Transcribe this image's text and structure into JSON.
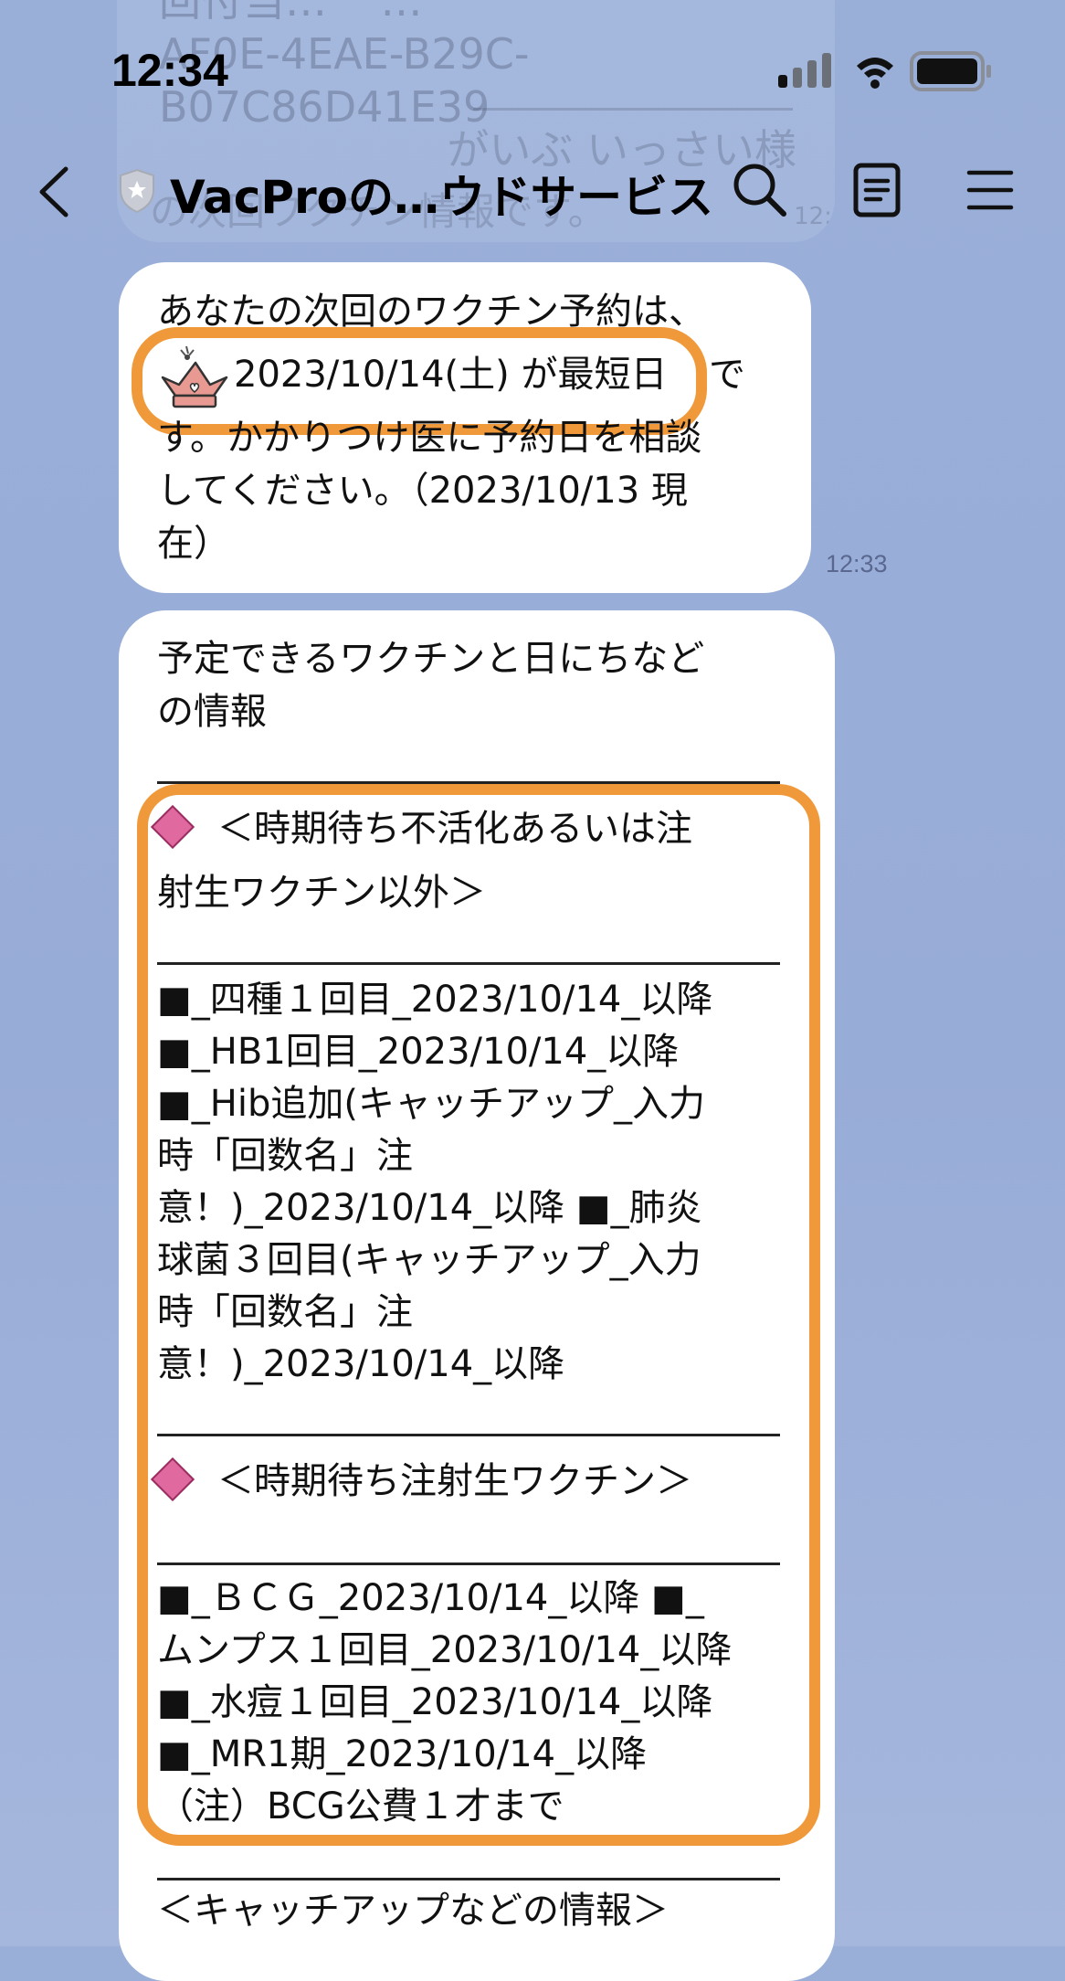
{
  "status_bar": {
    "time": "12:34"
  },
  "background_ghost": {
    "line1": "回付当…    …",
    "line2": "AF0E-4EAE-B29C-",
    "line3": "B07C86D41E39",
    "greeting": "がいぶ いっさい様",
    "line5": "の次回ワクチン情報です。",
    "time": "12:28"
  },
  "header": {
    "title": "VacProの…ウドサービス",
    "icons": [
      "back-arrow-icon",
      "shield-icon",
      "search-icon",
      "notes-icon",
      "menu-icon"
    ]
  },
  "message1": {
    "line1": "あなたの次回のワクチン予約は、",
    "highlight_date": "2023/10/14(土) が最短日",
    "line2_tail": "で",
    "line3": "す。かかりつけ医に予約日を相談",
    "line4": "してください。（2023/10/13 現",
    "line5": "在）",
    "timestamp": "12:33"
  },
  "message2": {
    "heading1": "予定できるワクチンと日にちなど",
    "heading2": "の情報",
    "section1_title1": "＜時期待ち不活化あるいは注",
    "section1_title2": "射生ワクチン以外＞",
    "section1_lines": [
      "■_四種１回目_2023/10/14_以降",
      "■_HB1回目_2023/10/14_以降",
      "■_Hib追加(キャッチアップ_入力",
      "時「回数名」注",
      "意！)_2023/10/14_以降 ■_肺炎",
      "球菌３回目(キャッチアップ_入力",
      "時「回数名」注",
      "意！)_2023/10/14_以降"
    ],
    "section2_title": "＜時期待ち注射生ワクチン＞",
    "section2_lines": [
      "■_ＢＣＧ_2023/10/14_以降 ■_",
      "ムンプス１回目_2023/10/14_以降",
      "■_水痘１回目_2023/10/14_以降",
      "■_MR1期_2023/10/14_以降",
      "（注）BCG公費１才まで"
    ],
    "section3_title": "＜キャッチアップなどの情報＞"
  },
  "colors": {
    "background": "#9aafd8",
    "highlight": "#f0993a",
    "bubble": "#ffffff",
    "diamond": "#e06aa0"
  }
}
